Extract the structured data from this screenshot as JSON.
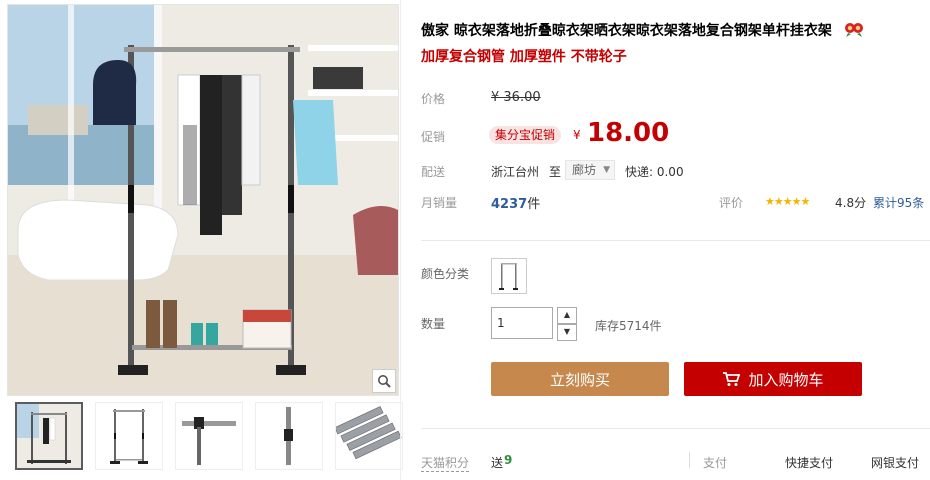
{
  "product": {
    "title": "傲家 晾衣架落地折叠晾衣架晒衣架晾衣架落地复合钢架单杆挂衣架",
    "subtitle": "加厚复合钢管 加厚塑件 不带轮子"
  },
  "price": {
    "label": "价格",
    "original": "¥ 36.00",
    "promo_label": "促销",
    "promo_badge": "集分宝促销",
    "currency": "¥",
    "promo_price": "18.00"
  },
  "shipping": {
    "label": "配送",
    "from": "浙江台州",
    "to_word": "至",
    "destination": "廊坊",
    "express": "快递: 0.00"
  },
  "sales": {
    "label": "月销量",
    "count": "4237",
    "unit": "件",
    "rating_label": "评价",
    "score": "4.8分",
    "reviews": "累计95条"
  },
  "sku": {
    "color_label": "颜色分类",
    "qty_label": "数量",
    "qty_value": "1",
    "stock": "库存5714件"
  },
  "buttons": {
    "buy_now": "立刻购买",
    "add_cart": "加入购物车"
  },
  "footer": {
    "points_label": "天猫积分",
    "points_give": "送",
    "points_value": "9",
    "pay_label": "支付",
    "pay_quick": "快捷支付",
    "pay_bank": "网银支付"
  },
  "colors": {
    "accent_red": "#c40000",
    "buy_button": "#c6884d",
    "star": "#f5b400"
  }
}
